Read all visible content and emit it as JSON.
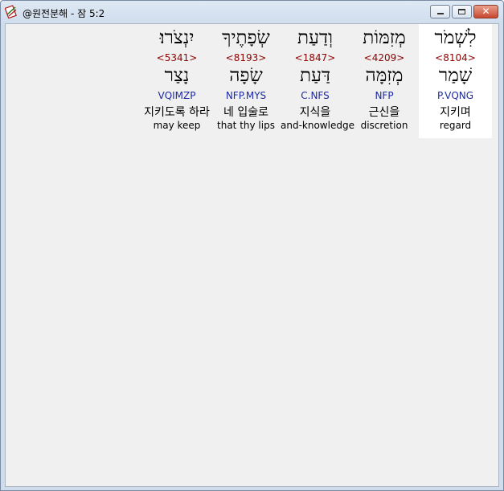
{
  "window": {
    "title": "@원전분해 - 잠 5:2",
    "icon": "bible-tool-icon"
  },
  "words": [
    {
      "hebrew": "לִשְׁמֹר",
      "strong": "<8104>",
      "lemma": "שָׁמַר",
      "morph": "P.VQNG",
      "korean": "지키며",
      "english": "regard",
      "selected": true
    },
    {
      "hebrew": "מְזִמּוֹת",
      "strong": "<4209>",
      "lemma": "מְזִמָּה",
      "morph": "NFP",
      "korean": "근신을",
      "english": "discretion",
      "selected": false
    },
    {
      "hebrew": "וְדַעַת",
      "strong": "<1847>",
      "lemma": "דַּעַת",
      "morph": "C.NFS",
      "korean": "지식을",
      "english": "and-knowledge",
      "selected": false
    },
    {
      "hebrew": "שְׂפָתֶיךָ",
      "strong": "<8193>",
      "lemma": "שָׂפָה",
      "morph": "NFP.MYS",
      "korean": "네 입술로",
      "english": "that thy lips",
      "selected": false
    },
    {
      "hebrew": "יִנְצֹרוּ׃",
      "strong": "<5341>",
      "lemma": "נָצַר",
      "morph": "VQIMZP",
      "korean": "지키도록 하라",
      "english": "may keep",
      "selected": false
    }
  ]
}
